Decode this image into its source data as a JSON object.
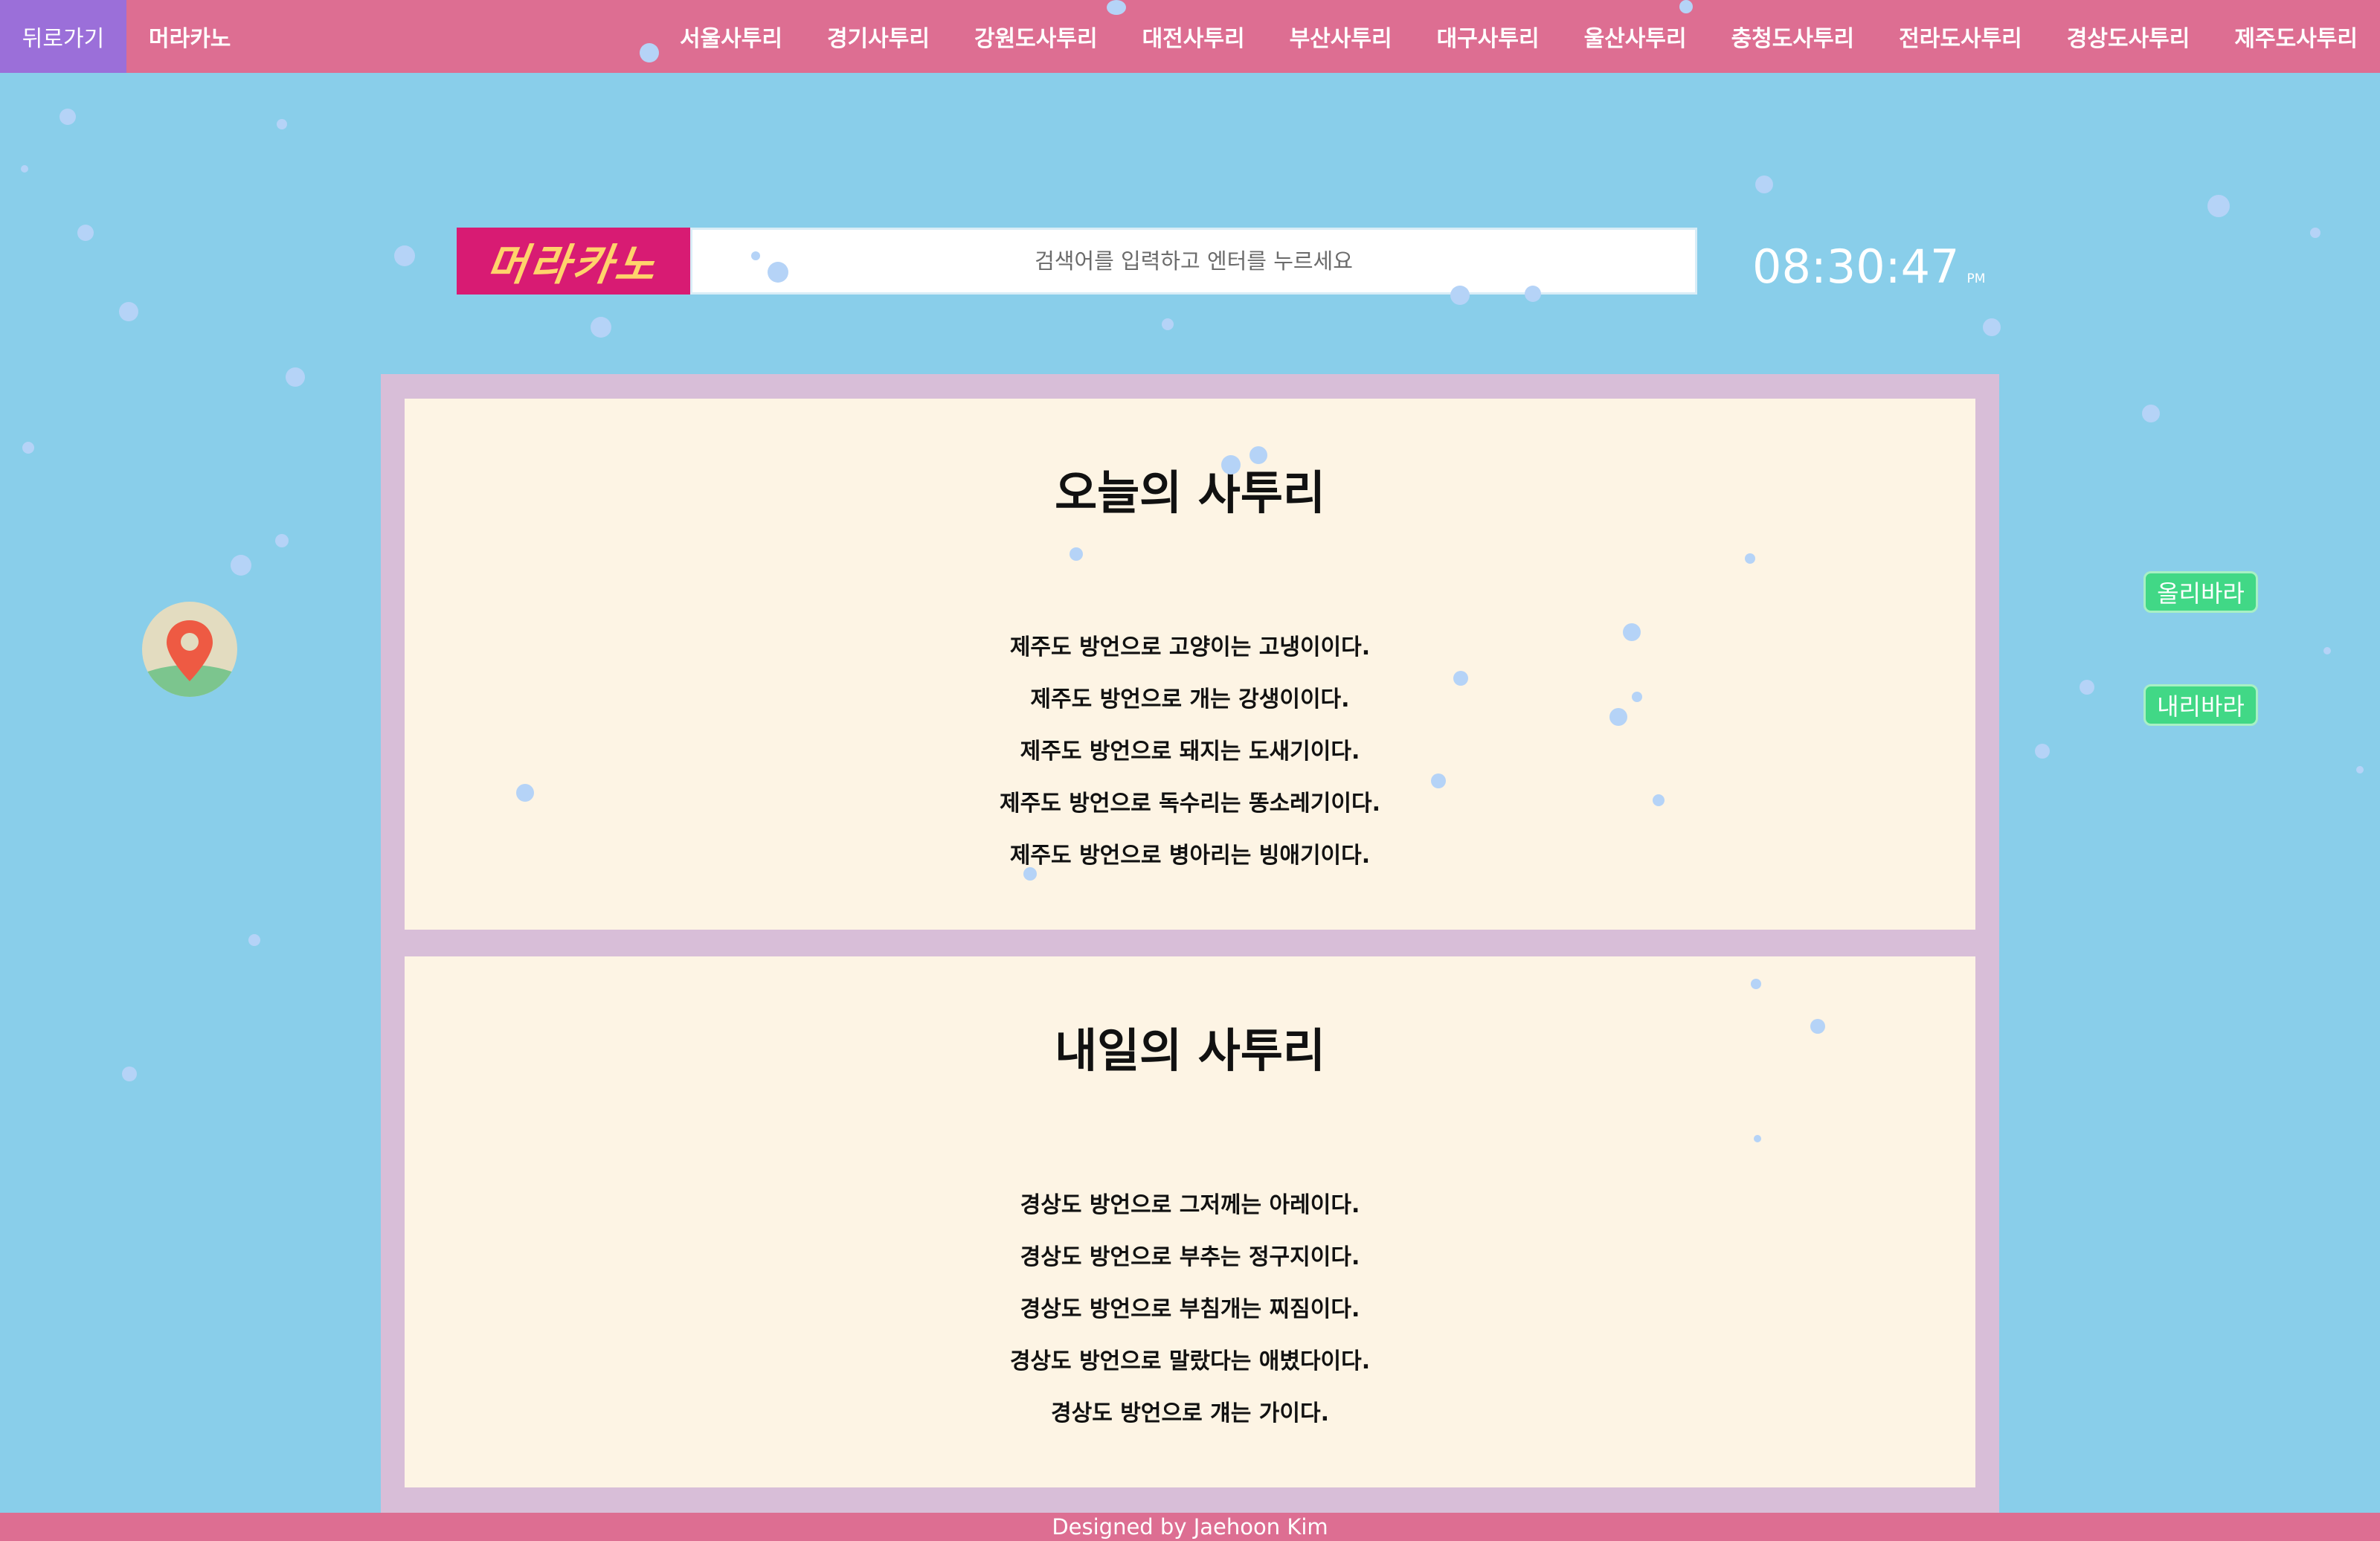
{
  "nav": {
    "back_label": "뒤로가기",
    "brand": "머라카노",
    "regions": [
      "서울사투리",
      "경기사투리",
      "강원도사투리",
      "대전사투리",
      "부산사투리",
      "대구사투리",
      "울산사투리",
      "충청도사투리",
      "전라도사투리",
      "경상도사투리",
      "제주도사투리"
    ]
  },
  "search": {
    "logo_text": "머라카노",
    "placeholder": "검색어를 입력하고 엔터를 누르세요"
  },
  "clock": {
    "time": "08:30:47",
    "ampm": "PM"
  },
  "today": {
    "title": "오늘의 사투리",
    "items": [
      "제주도 방언으로 고양이는 고냉이이다.",
      "제주도 방언으로 개는 강생이이다.",
      "제주도 방언으로 돼지는 도새기이다.",
      "제주도 방언으로 독수리는 똥소레기이다.",
      "제주도 방언으로 병아리는 빙애기이다."
    ]
  },
  "tomorrow": {
    "title": "내일의 사투리",
    "items": [
      "경상도 방언으로 그저께는 아레이다.",
      "경상도 방언으로 부추는 정구지이다.",
      "경상도 방언으로 부침개는 찌짐이다.",
      "경상도 방언으로 말랐다는 애볐다이다.",
      "경상도 방언으로 걔는 가이다."
    ]
  },
  "side_buttons": {
    "up": "올리바라",
    "down": "내리바라"
  },
  "icons": {
    "map_pin": "map-pin-icon"
  },
  "colors": {
    "background": "#89ceea",
    "nav": "#dd6e92",
    "back_button": "#9b6fd9",
    "frame": "#d8bed8",
    "panel": "#fdf4e4",
    "logo_bg": "#d81b73",
    "button_green": "#41d886"
  },
  "footer": {
    "credit": "Designed by Jaehoon Kim"
  }
}
